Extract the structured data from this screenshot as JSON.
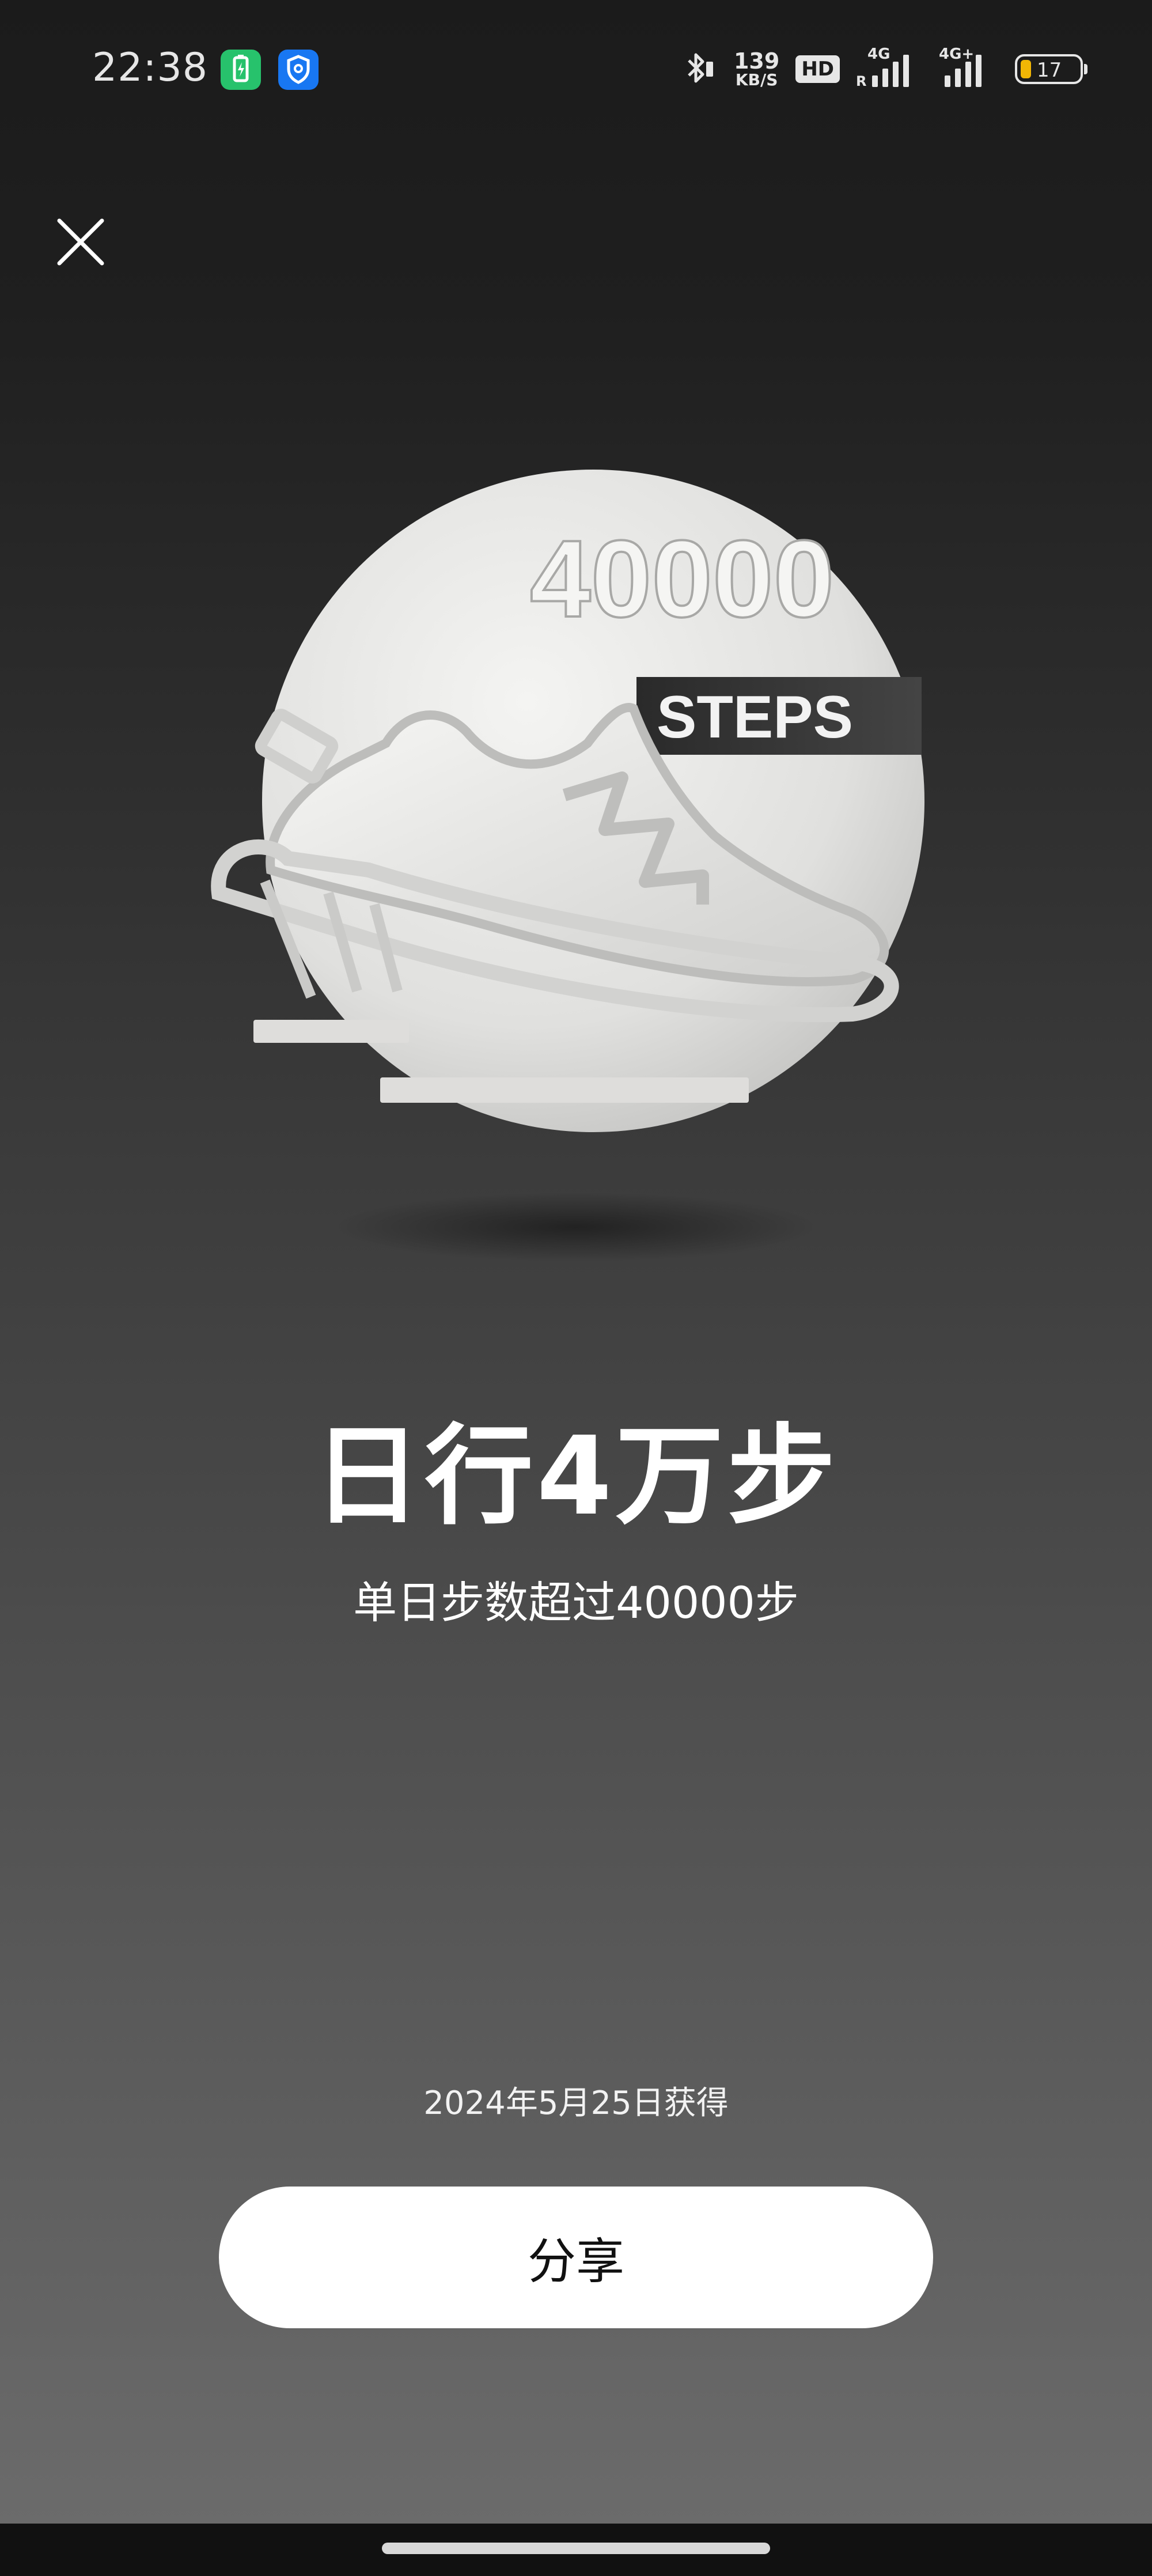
{
  "status_bar": {
    "time": "22:38",
    "net_speed_value": "139",
    "net_speed_unit": "KB/S",
    "hd_label": "HD",
    "signal1_label": "4G",
    "signal1_sub": "R",
    "signal2_label": "4G+",
    "battery_level": "17",
    "icons": [
      "battery-saver-app-icon",
      "shield-app-icon",
      "bluetooth-icon",
      "signal-icon",
      "battery-icon"
    ]
  },
  "medal": {
    "badge_number": "40000",
    "badge_text": "STEPS",
    "title": "日行4万步",
    "description": "单日步数超过40000步",
    "earned_date": "2024年5月25日获得"
  },
  "actions": {
    "share_label": "分享"
  },
  "colors": {
    "background_top": "#1b1b1b",
    "background_bottom": "#6b6b6b",
    "share_button_bg": "#ffffff",
    "battery_fill": "#f2b705",
    "badge_green": "#27c26c",
    "badge_blue": "#1877f2"
  }
}
